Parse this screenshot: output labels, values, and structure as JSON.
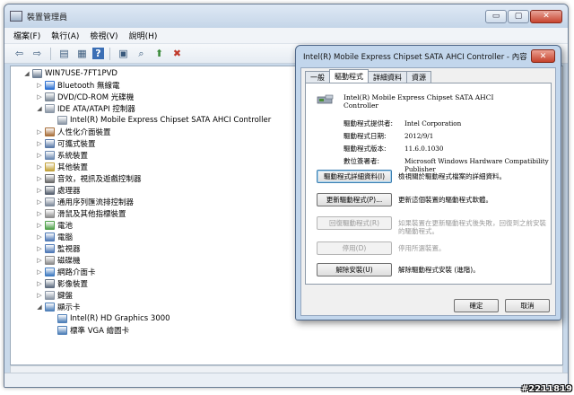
{
  "window": {
    "title": "裝置管理員",
    "minimize": "▭",
    "maximize": "▢",
    "close": "✕"
  },
  "menu": [
    "檔案(F)",
    "執行(A)",
    "檢視(V)",
    "說明(H)"
  ],
  "toolbar": [
    {
      "icon": "back-arrow-icon",
      "glyph": "⇦"
    },
    {
      "icon": "forward-arrow-icon",
      "glyph": "⇨"
    },
    {
      "icon": "properties-icon",
      "glyph": "▤"
    },
    {
      "icon": "details-icon",
      "glyph": "▦"
    },
    {
      "icon": "help-icon",
      "glyph": "?"
    },
    {
      "icon": "view-icon",
      "glyph": "▣"
    },
    {
      "icon": "scan-hardware-icon",
      "glyph": "⌕"
    },
    {
      "icon": "update-driver-icon",
      "glyph": "⬆"
    },
    {
      "icon": "uninstall-icon",
      "glyph": "✖"
    }
  ],
  "tree": [
    {
      "label": "WIN7USE-7FT1PVD",
      "indent": 0,
      "expander": "◢",
      "color": "#6e7f94"
    },
    {
      "label": "Bluetooth 無線電",
      "indent": 1,
      "expander": "▷",
      "color": "#2b6fd0"
    },
    {
      "label": "DVD/CD-ROM 光碟機",
      "indent": 1,
      "expander": "▷",
      "color": "#7b8796"
    },
    {
      "label": "IDE ATA/ATAPI 控制器",
      "indent": 1,
      "expander": "◢",
      "color": "#8a96a5"
    },
    {
      "label": "Intel(R) Mobile Express Chipset SATA AHCI Controller",
      "indent": 2,
      "expander": "",
      "color": "#8a96a5"
    },
    {
      "label": "人性化介面裝置",
      "indent": 1,
      "expander": "▷",
      "color": "#a86f3a"
    },
    {
      "label": "可攜式裝置",
      "indent": 1,
      "expander": "▷",
      "color": "#5a7aa8"
    },
    {
      "label": "系統裝置",
      "indent": 1,
      "expander": "▷",
      "color": "#6b88b0"
    },
    {
      "label": "其他裝置",
      "indent": 1,
      "expander": "▷",
      "color": "#c3a23a"
    },
    {
      "label": "音效，視訊及遊戲控制器",
      "indent": 1,
      "expander": "▷",
      "color": "#6a6a6a"
    },
    {
      "label": "處理器",
      "indent": 1,
      "expander": "▷",
      "color": "#555f6e"
    },
    {
      "label": "通用序列匯流排控制器",
      "indent": 1,
      "expander": "▷",
      "color": "#7c8899"
    },
    {
      "label": "滑鼠及其他指標裝置",
      "indent": 1,
      "expander": "▷",
      "color": "#8d8d8d"
    },
    {
      "label": "電池",
      "indent": 1,
      "expander": "▷",
      "color": "#4fa04a"
    },
    {
      "label": "電腦",
      "indent": 1,
      "expander": "▷",
      "color": "#4f79b6"
    },
    {
      "label": "監視器",
      "indent": 1,
      "expander": "▷",
      "color": "#4f79b6"
    },
    {
      "label": "磁碟機",
      "indent": 1,
      "expander": "▷",
      "color": "#8a8a8a"
    },
    {
      "label": "網路介面卡",
      "indent": 1,
      "expander": "▷",
      "color": "#3e7ac0"
    },
    {
      "label": "影像裝置",
      "indent": 1,
      "expander": "▷",
      "color": "#5f6d80"
    },
    {
      "label": "鍵盤",
      "indent": 1,
      "expander": "▷",
      "color": "#8a96a5"
    },
    {
      "label": "顯示卡",
      "indent": 1,
      "expander": "◢",
      "color": "#4e7fb8"
    },
    {
      "label": "Intel(R) HD Graphics 3000",
      "indent": 2,
      "expander": "",
      "color": "#4e7fb8"
    },
    {
      "label": "標準 VGA 繪圖卡",
      "indent": 2,
      "expander": "",
      "color": "#4e7fb8"
    }
  ],
  "dialog": {
    "title": "Intel(R) Mobile Express Chipset SATA AHCI Controller - 內容",
    "close": "✕",
    "tabs": [
      "一般",
      "驅動程式",
      "詳細資料",
      "資源"
    ],
    "active_tab": 1,
    "device_name": "Intel(R) Mobile Express Chipset SATA AHCI Controller",
    "props": [
      {
        "label": "驅動程式提供者:",
        "value": "Intel Corporation"
      },
      {
        "label": "驅動程式日期:",
        "value": "2012/9/1"
      },
      {
        "label": "驅動程式版本:",
        "value": "11.6.0.1030"
      },
      {
        "label": "數位簽署者:",
        "value": "Microsoft Windows Hardware Compatibility Publisher"
      }
    ],
    "actions": [
      {
        "name": "driver-details-button",
        "label": "驅動程式詳細資料(I)",
        "desc": "檢視關於驅動程式檔案的詳細資料。",
        "disabled": false,
        "focused": true
      },
      {
        "name": "update-driver-button",
        "label": "更新驅動程式(P)...",
        "desc": "更新這個裝置的驅動程式軟體。",
        "disabled": false,
        "focused": false
      },
      {
        "name": "roll-back-driver-button",
        "label": "回復驅動程式(R)",
        "desc": "如果裝置在更新驅動程式後失敗，回復到之前安裝的驅動程式。",
        "disabled": true,
        "focused": false
      },
      {
        "name": "disable-button",
        "label": "停用(D)",
        "desc": "停用所選裝置。",
        "disabled": true,
        "focused": false
      },
      {
        "name": "uninstall-button",
        "label": "解除安裝(U)",
        "desc": "解除驅動程式安裝 (進階)。",
        "disabled": false,
        "focused": false
      }
    ],
    "ok": "確定",
    "cancel": "取消"
  },
  "watermark": "#2211819"
}
